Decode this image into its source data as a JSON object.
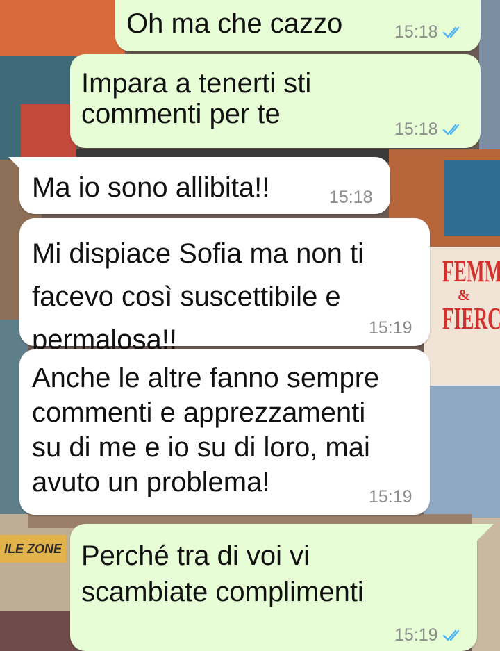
{
  "messages": [
    {
      "direction": "outgoing",
      "text": "Oh ma che cazzo",
      "time": "15:18",
      "status": "read"
    },
    {
      "direction": "outgoing",
      "text": "Impara a tenerti sti\ncommenti per te",
      "time": "15:18",
      "status": "read"
    },
    {
      "direction": "incoming",
      "text": "Ma io sono allibita!!",
      "time": "15:18"
    },
    {
      "direction": "incoming",
      "text": "Mi dispiace Sofia ma non ti\nfacevo così suscettibile e\npermalosa!!",
      "time": "15:19"
    },
    {
      "direction": "incoming",
      "text": "Anche le altre fanno sempre\ncommenti e apprezzamenti\nsu di me e io su di loro, mai\navuto un problema!",
      "time": "15:19"
    },
    {
      "direction": "outgoing",
      "text": "Perché tra di voi vi\nscambiate complimenti",
      "time": "15:19",
      "status": "read"
    }
  ],
  "wallpaper": {
    "poster_femme": "FEMME",
    "poster_amp": "&",
    "poster_fierce": "FIERCE",
    "sign_zone": "ILE ZONE"
  },
  "colors": {
    "outgoing_bubble": "#e6fdd6",
    "incoming_bubble": "#ffffff",
    "read_ticks": "#4fb3f6",
    "timestamp": "#8a8f8a"
  }
}
